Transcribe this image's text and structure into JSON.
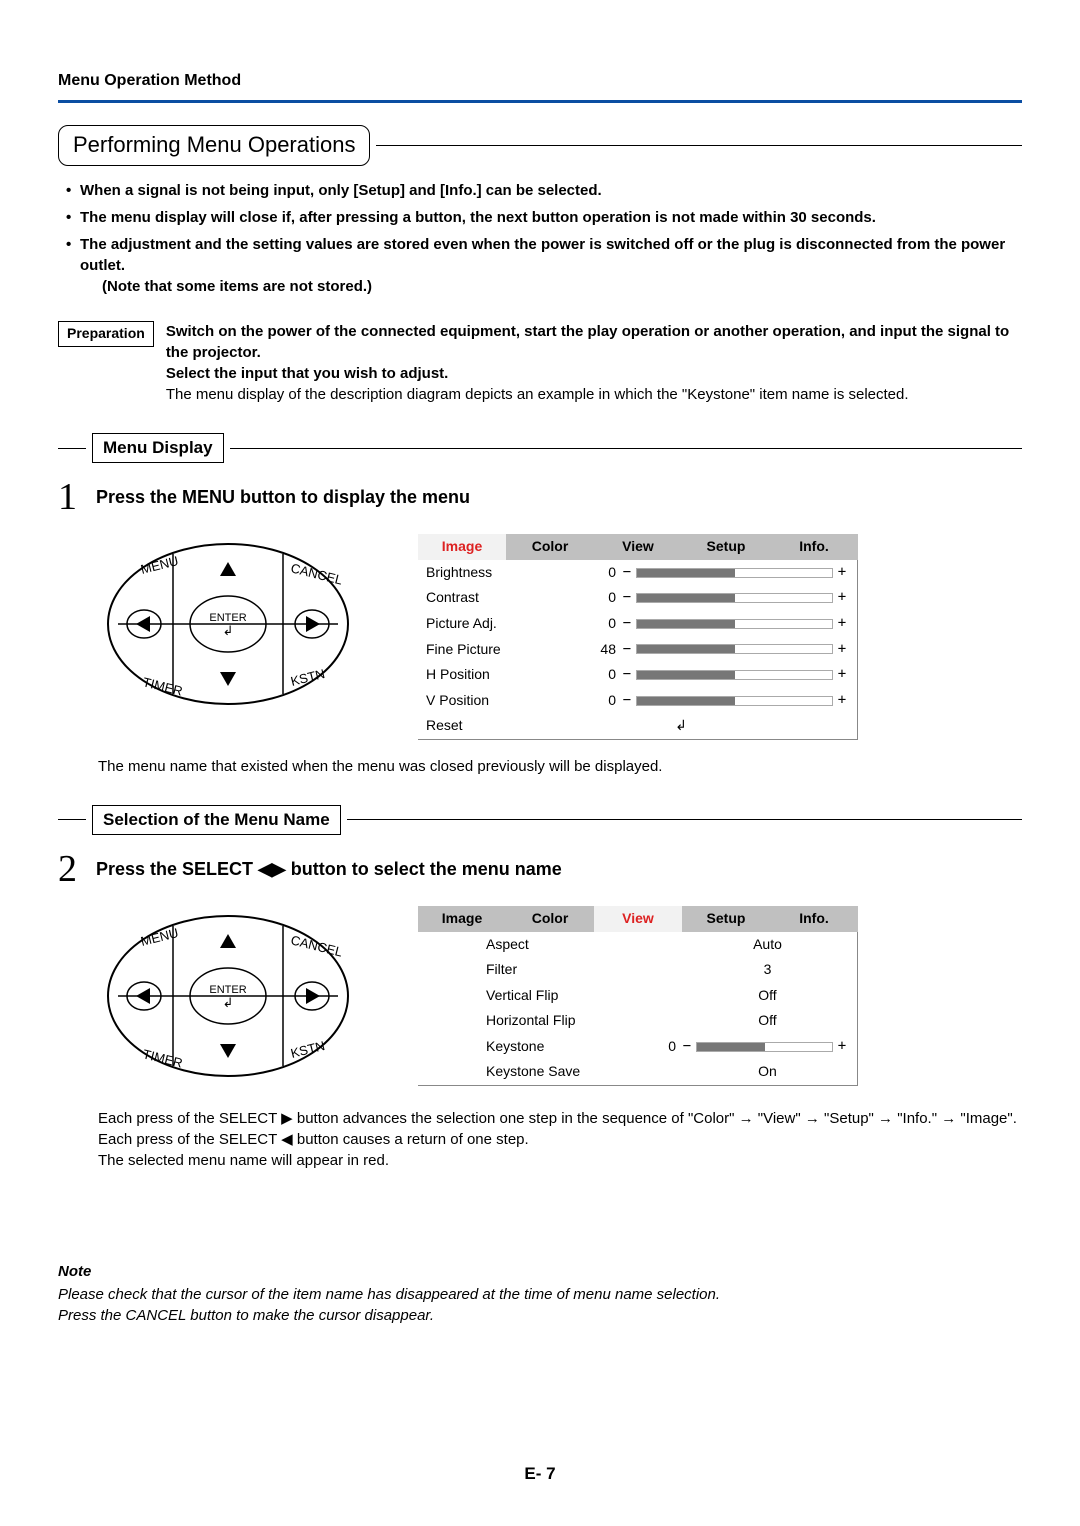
{
  "header": {
    "title": "Menu Operation Method"
  },
  "section": {
    "title": "Performing Menu Operations"
  },
  "bullets": [
    "When a signal is not being input, only [Setup] and [Info.] can be selected.",
    "The menu display will close if, after pressing a button, the next button operation is not made within 30 seconds.",
    "The adjustment and the setting values are stored even when the power is switched off or the plug is disconnected from the power outlet."
  ],
  "bullets_note": "(Note that some items are not stored.)",
  "prep": {
    "label": "Preparation",
    "line1": "Switch on the power of the connected equipment, start the play operation or another operation, and input the signal to the projector.",
    "line2": "Select the input that you wish to adjust.",
    "line3": "The menu display of the description diagram depicts an example in which the \"Keystone\" item name is selected."
  },
  "sub1": {
    "title": "Menu Display"
  },
  "step1": {
    "num": "1",
    "text": "Press the MENU button to display the menu",
    "tabs": [
      "Image",
      "Color",
      "View",
      "Setup",
      "Info."
    ],
    "active_tab": 0,
    "rows": [
      {
        "label": "Brightness",
        "value": "0",
        "slider": true
      },
      {
        "label": "Contrast",
        "value": "0",
        "slider": true
      },
      {
        "label": "Picture Adj.",
        "value": "0",
        "slider": true
      },
      {
        "label": "Fine Picture",
        "value": "48",
        "slider": true
      },
      {
        "label": "H Position",
        "value": "0",
        "slider": true
      },
      {
        "label": "V Position",
        "value": "0",
        "slider": true
      },
      {
        "label": "Reset",
        "enter": true
      }
    ],
    "desc": "The menu name that existed when the menu was closed previously will be displayed."
  },
  "sub2": {
    "title": "Selection of the Menu Name"
  },
  "step2": {
    "num": "2",
    "text_pre": "Press the SELECT ",
    "text_post": " button to select the menu name",
    "tabs": [
      "Image",
      "Color",
      "View",
      "Setup",
      "Info."
    ],
    "active_tab": 2,
    "rows": [
      {
        "label": "Aspect",
        "right": "Auto"
      },
      {
        "label": "Filter",
        "right": "3"
      },
      {
        "label": "Vertical Flip",
        "right": "Off"
      },
      {
        "label": "Horizontal Flip",
        "right": "Off"
      },
      {
        "label": "Keystone",
        "value": "0",
        "slider": true,
        "wide": true
      },
      {
        "label": "Keystone Save",
        "right": "On"
      }
    ],
    "desc1": "Each press of the SELECT ▶ button advances the selection one step in the sequence of \"Color\" → \"View\" → \"Setup\" → \"Info.\" → \"Image\". Each press of the SELECT ◀ button causes a return of one step.",
    "desc2": "The selected menu name will appear in red."
  },
  "note": {
    "title": "Note",
    "line1": "Please check that the cursor of the item name has disappeared at the time of menu name selection.",
    "line2": "Press the CANCEL button to make the cursor disappear."
  },
  "footer": {
    "label": "E-  7"
  },
  "dpad": {
    "menu": "MENU",
    "cancel": "CANCEL",
    "enter": "ENTER",
    "timer": "TIMER",
    "kstn": "KSTN"
  }
}
